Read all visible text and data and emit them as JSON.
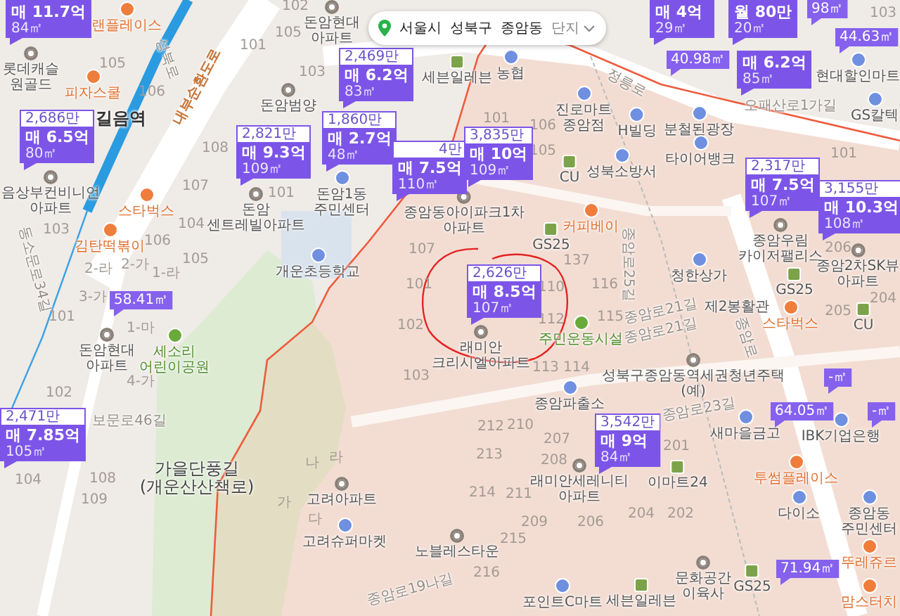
{
  "location_bar": {
    "crumbs": [
      "서울시",
      "성북구",
      "종암동"
    ],
    "filter": "단지"
  },
  "listings": [
    {
      "kind": "sale",
      "price": "매 11.7억",
      "area": "84㎡"
    },
    {
      "kind": "sale",
      "price": "매 4억",
      "area": "29㎡"
    },
    {
      "kind": "sale",
      "price": "월 80만",
      "area": "20㎡"
    },
    {
      "kind": "area",
      "area": "98㎡"
    },
    {
      "kind": "sale",
      "unit_price": "2,469만",
      "price": "매 6.2억",
      "area": "83㎡"
    },
    {
      "kind": "area",
      "area": "40.98㎡"
    },
    {
      "kind": "sale",
      "price": "매 6.2억",
      "area": "85㎡"
    },
    {
      "kind": "area",
      "area": "44.63㎡"
    },
    {
      "kind": "sale",
      "unit_price": "2,686만",
      "price": "매 6.5억",
      "area": "80㎡"
    },
    {
      "kind": "sale",
      "unit_price": "2,821만",
      "price": "매 9.3억",
      "area": "109㎡"
    },
    {
      "kind": "sale",
      "unit_price": "1,860만",
      "price": "매 2.7억",
      "area": "48㎡"
    },
    {
      "kind": "sale",
      "unit_price": "4만",
      "price": "매 7.5억",
      "area": "110㎡"
    },
    {
      "kind": "sale",
      "unit_price": "3,835만",
      "price": "매 10억",
      "area": "109㎡"
    },
    {
      "kind": "sale",
      "unit_price": "2,317만",
      "price": "매 7.5억",
      "area": "107㎡"
    },
    {
      "kind": "sale",
      "unit_price": "3,155만",
      "price": "매 10.3억",
      "area": "108㎡"
    },
    {
      "kind": "area",
      "area": "58.41㎡"
    },
    {
      "kind": "sale",
      "unit_price": "2,626만",
      "price": "매 8.5억",
      "area": "107㎡"
    },
    {
      "kind": "area",
      "area": "64.05㎡"
    },
    {
      "kind": "area",
      "area": "-㎡"
    },
    {
      "kind": "sale",
      "unit_price": "2,471만",
      "price": "매 7.85억",
      "area": "105㎡"
    },
    {
      "kind": "sale",
      "unit_price": "3,542만",
      "price": "매 9억",
      "area": "84㎡"
    },
    {
      "kind": "area",
      "area": "-㎡"
    },
    {
      "kind": "area",
      "area": "71.94㎡"
    }
  ],
  "places": [
    {
      "name": "랜플레이스",
      "kind": "food"
    },
    {
      "name": "돈암현대 아파트",
      "kind": "apartment"
    },
    {
      "name": "롯데캐슬 원골드",
      "kind": "apartment"
    },
    {
      "name": "세븐일레븐",
      "kind": "store"
    },
    {
      "name": "농협",
      "kind": "office"
    },
    {
      "name": "현대할인마트",
      "kind": "office"
    },
    {
      "name": "피자스쿨",
      "kind": "food"
    },
    {
      "name": "길음역",
      "kind": "station"
    },
    {
      "name": "돈암범양",
      "kind": "apartment"
    },
    {
      "name": "진로마트 종암점",
      "kind": "office"
    },
    {
      "name": "GS칼텍",
      "kind": "office"
    },
    {
      "name": "H빌딩",
      "kind": "office"
    },
    {
      "name": "분철된광장",
      "kind": "office"
    },
    {
      "name": "타이어뱅크",
      "kind": "office"
    },
    {
      "name": "CU",
      "kind": "store"
    },
    {
      "name": "성북소방서",
      "kind": "office"
    },
    {
      "name": "음상부컨비니언 아파트",
      "kind": "apartment"
    },
    {
      "name": "스타벅스",
      "kind": "food"
    },
    {
      "name": "돈암 센트레빌아파트",
      "kind": "apartment"
    },
    {
      "name": "돈암1동 주민센터",
      "kind": "office"
    },
    {
      "name": "종암동아이파크1차 아파트",
      "kind": "apartment"
    },
    {
      "name": "커피베이",
      "kind": "food"
    },
    {
      "name": "김탄떡볶이",
      "kind": "food"
    },
    {
      "name": "GS25",
      "kind": "store"
    },
    {
      "name": "종암우림 카이저팰리스",
      "kind": "apartment"
    },
    {
      "name": "개운초등학교",
      "kind": "office"
    },
    {
      "name": "청한상가",
      "kind": "office"
    },
    {
      "name": "종암2차SK뷰 아파트",
      "kind": "apartment"
    },
    {
      "name": "GS25",
      "kind": "store"
    },
    {
      "name": "제2봉활관",
      "kind": "plain"
    },
    {
      "name": "스타벅스",
      "kind": "food"
    },
    {
      "name": "CU",
      "kind": "store"
    },
    {
      "name": "돈암현대 아파트",
      "kind": "apartment"
    },
    {
      "name": "세소리 어린이공원",
      "kind": "park"
    },
    {
      "name": "래미안 크리시엘아파트",
      "kind": "apartment"
    },
    {
      "name": "주민운동시설",
      "kind": "park"
    },
    {
      "name": "성북구종암동역세권청년주택 (예)",
      "kind": "apartment"
    },
    {
      "name": "종암파출소",
      "kind": "office"
    },
    {
      "name": "새마을금고",
      "kind": "office"
    },
    {
      "name": "IBK기업은행",
      "kind": "office"
    },
    {
      "name": "가을단풍길 (개운산산책로)",
      "kind": "area"
    },
    {
      "name": "래미안세레니티 아파트",
      "kind": "apartment"
    },
    {
      "name": "이마트24",
      "kind": "store"
    },
    {
      "name": "투썸플레이스",
      "kind": "food"
    },
    {
      "name": "고려아파트",
      "kind": "apartment"
    },
    {
      "name": "다이소",
      "kind": "office"
    },
    {
      "name": "종암동 주민센터",
      "kind": "office"
    },
    {
      "name": "고려슈퍼마켓",
      "kind": "office"
    },
    {
      "name": "노블레스타운",
      "kind": "apartment"
    },
    {
      "name": "뚜레쥬르",
      "kind": "food"
    },
    {
      "name": "문화공간 이육사",
      "kind": "apartment"
    },
    {
      "name": "GS25",
      "kind": "store"
    },
    {
      "name": "포인트C마트",
      "kind": "office"
    },
    {
      "name": "세븐일레븐",
      "kind": "store"
    },
    {
      "name": "맘스터치",
      "kind": "food"
    }
  ],
  "roads": [
    {
      "name": "성북로",
      "kind": "street"
    },
    {
      "name": "내부순환도로",
      "kind": "highway"
    },
    {
      "name": "정릉로",
      "kind": "street"
    },
    {
      "name": "오패산로1가길",
      "kind": "street"
    },
    {
      "name": "동소문로34길",
      "kind": "street"
    },
    {
      "name": "종암로25길",
      "kind": "street"
    },
    {
      "name": "종암로21길",
      "kind": "street"
    },
    {
      "name": "종암로21길",
      "kind": "street"
    },
    {
      "name": "종암로",
      "kind": "street"
    },
    {
      "name": "보문로46길",
      "kind": "street"
    },
    {
      "name": "종암로23길",
      "kind": "street"
    },
    {
      "name": "종암로19나길",
      "kind": "street"
    }
  ],
  "building_numbers": [
    "102",
    "103",
    "105",
    "101",
    "105",
    "103",
    "106",
    "101",
    "106",
    "108",
    "105",
    "101",
    "107",
    "101",
    "103",
    "104",
    "106",
    "107",
    "206",
    "2-라",
    "2-가",
    "1-라",
    "105",
    "137",
    "3-가",
    "101",
    "110",
    "116",
    "204",
    "101",
    "1-마",
    "102",
    "112",
    "115",
    "205",
    "4-가",
    "103",
    "113",
    "114",
    "102",
    "212",
    "210",
    "207",
    "201",
    "나",
    "라",
    "213",
    "208",
    "104",
    "108",
    "109",
    "가",
    "214",
    "211",
    "다",
    "209",
    "206",
    "204",
    "202",
    "215",
    "216"
  ]
}
